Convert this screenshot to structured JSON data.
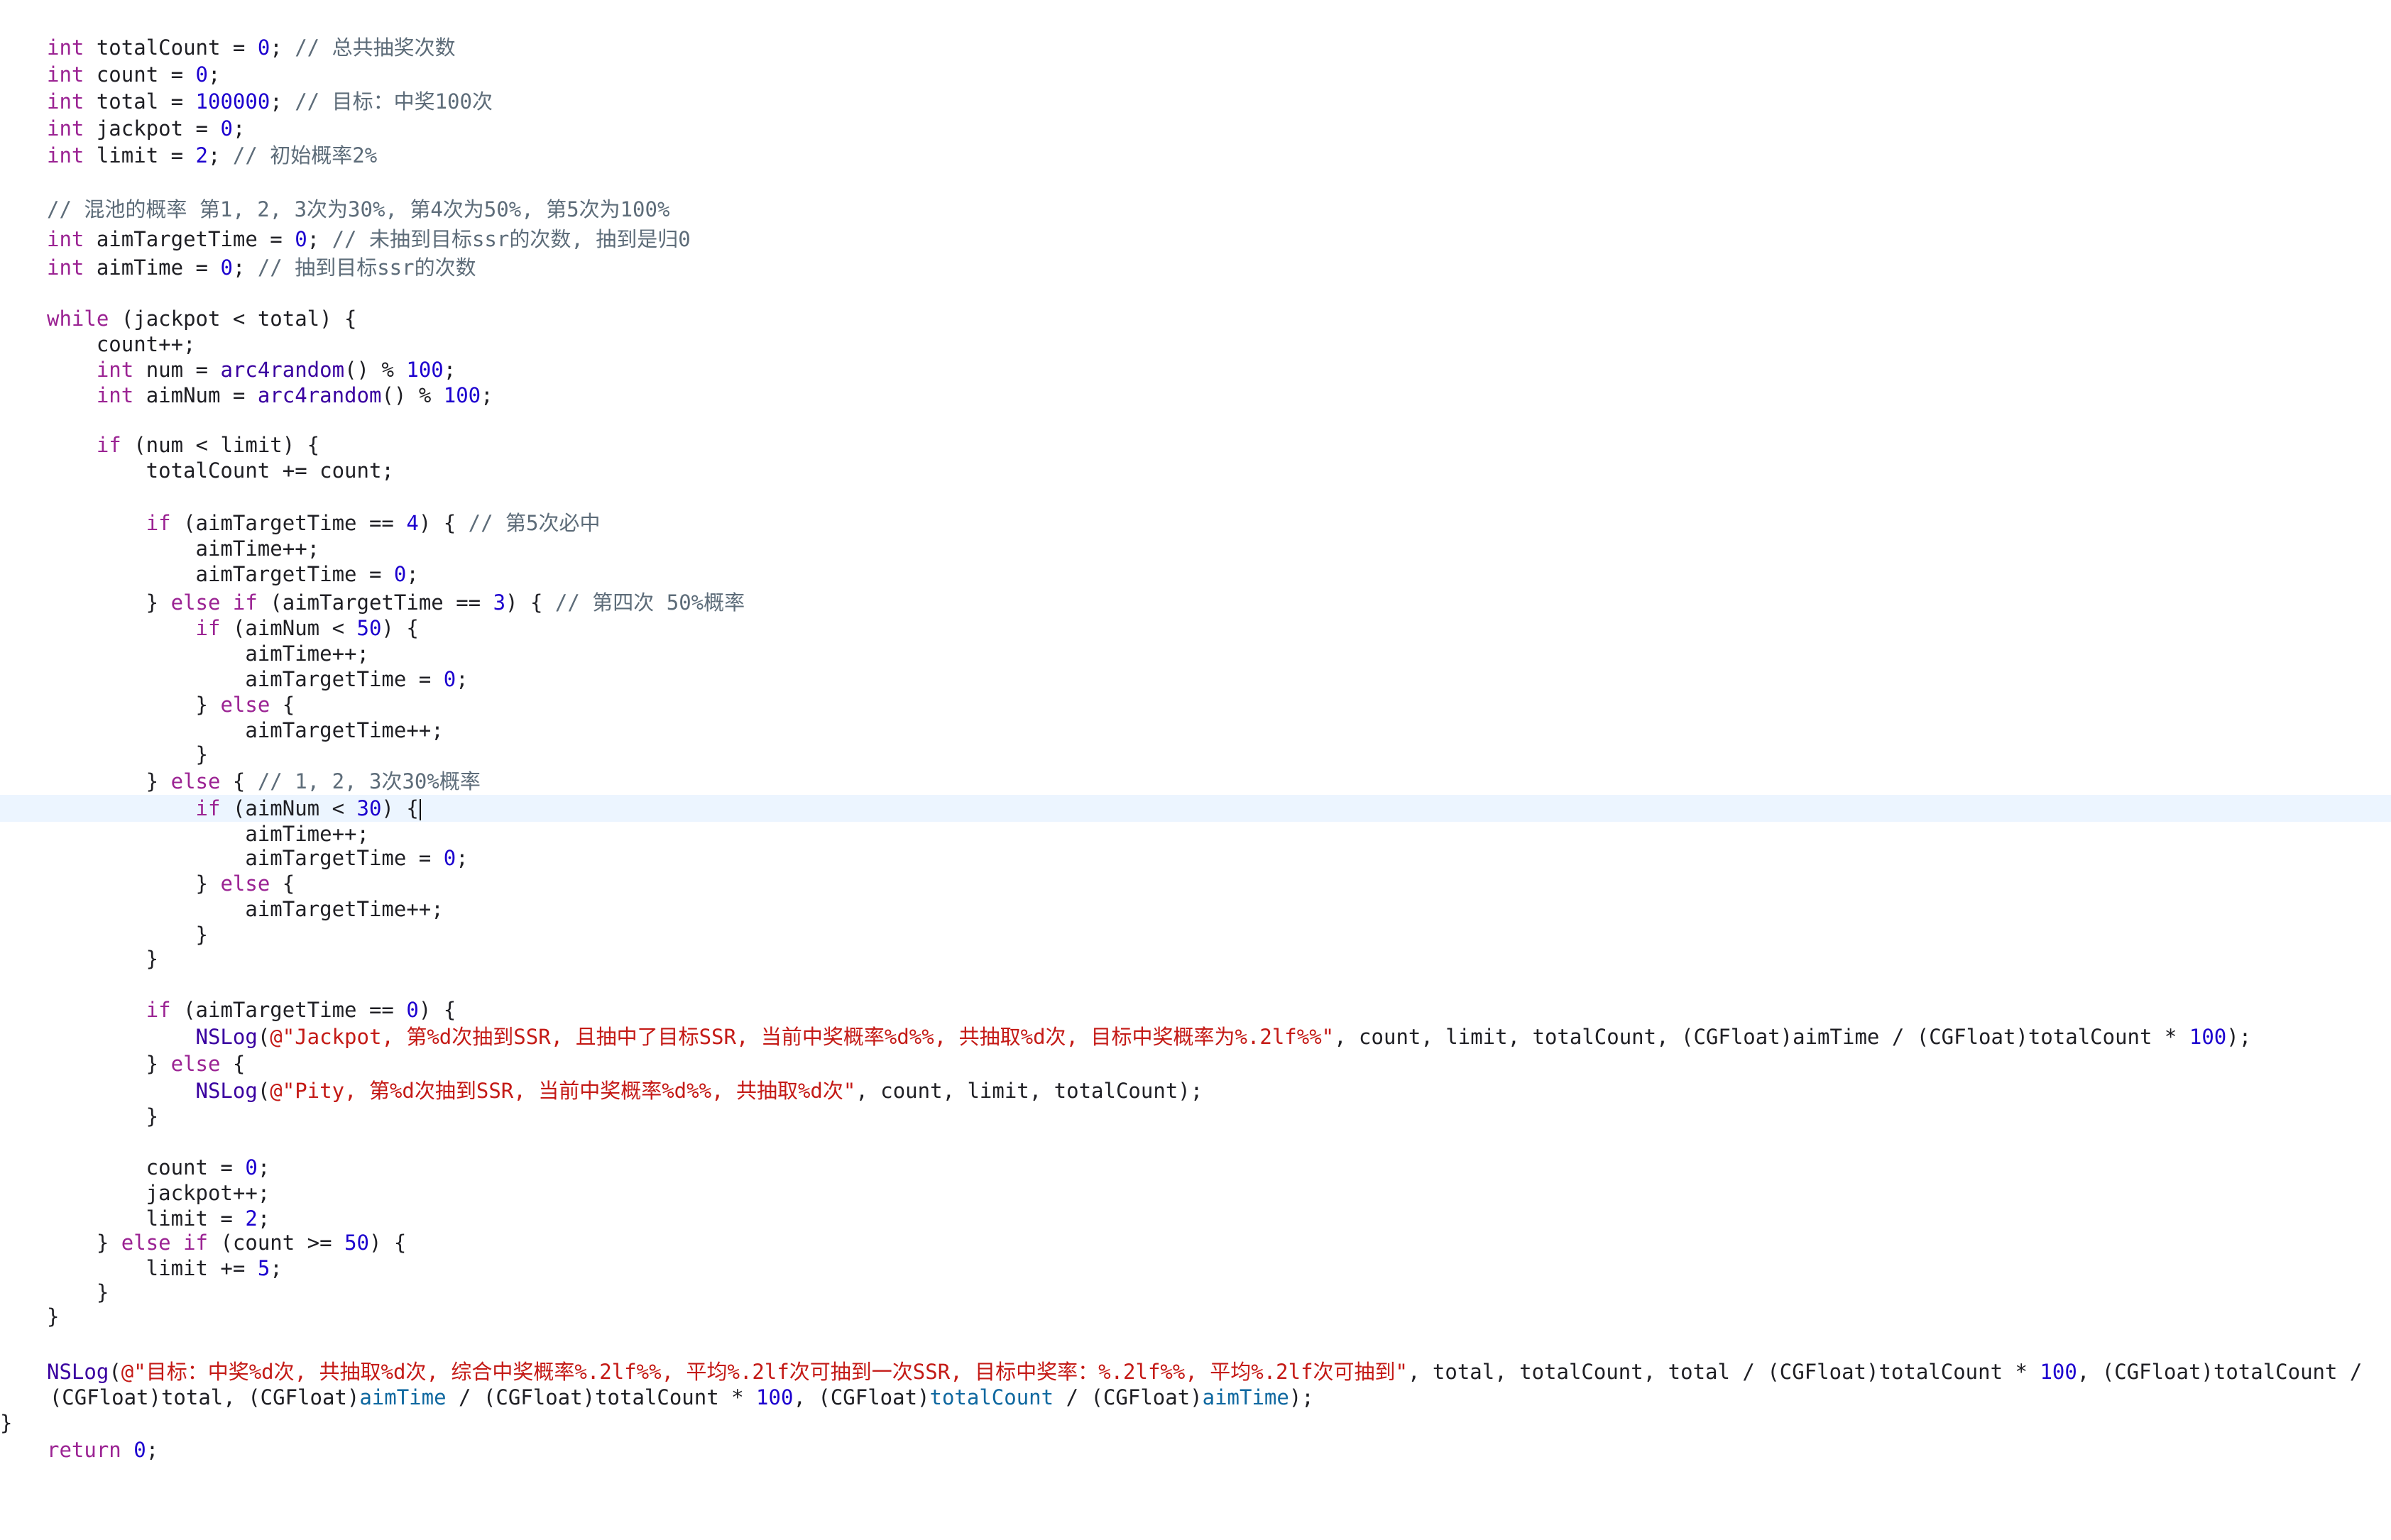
{
  "editor": {
    "colors": {
      "keyword": "#9b2393",
      "number": "#1c00cf",
      "comment": "#5d6c79",
      "string": "#c41a16",
      "function": "#3900a0",
      "variable": "#0f68a0",
      "plain": "#1f1f24",
      "current_line": "#ecf5ff"
    },
    "current_line_index": 29,
    "lines": [
      [
        {
          "t": "k",
          "s": "int"
        },
        {
          "t": "p",
          "s": " totalCount = "
        },
        {
          "t": "n",
          "s": "0"
        },
        {
          "t": "p",
          "s": "; "
        },
        {
          "t": "c",
          "s": "// 总共抽奖次数"
        }
      ],
      [
        {
          "t": "k",
          "s": "int"
        },
        {
          "t": "p",
          "s": " count = "
        },
        {
          "t": "n",
          "s": "0"
        },
        {
          "t": "p",
          "s": ";"
        }
      ],
      [
        {
          "t": "k",
          "s": "int"
        },
        {
          "t": "p",
          "s": " total = "
        },
        {
          "t": "n",
          "s": "100000"
        },
        {
          "t": "p",
          "s": "; "
        },
        {
          "t": "c",
          "s": "// 目标：中奖100次"
        }
      ],
      [
        {
          "t": "k",
          "s": "int"
        },
        {
          "t": "p",
          "s": " jackpot = "
        },
        {
          "t": "n",
          "s": "0"
        },
        {
          "t": "p",
          "s": ";"
        }
      ],
      [
        {
          "t": "k",
          "s": "int"
        },
        {
          "t": "p",
          "s": " limit = "
        },
        {
          "t": "n",
          "s": "2"
        },
        {
          "t": "p",
          "s": "; "
        },
        {
          "t": "c",
          "s": "// 初始概率2%"
        }
      ],
      [],
      [
        {
          "t": "c",
          "s": "// 混池的概率 第1, 2, 3次为30%, 第4次为50%, 第5次为100%"
        }
      ],
      [
        {
          "t": "k",
          "s": "int"
        },
        {
          "t": "p",
          "s": " aimTargetTime = "
        },
        {
          "t": "n",
          "s": "0"
        },
        {
          "t": "p",
          "s": "; "
        },
        {
          "t": "c",
          "s": "// 未抽到目标ssr的次数, 抽到是归0"
        }
      ],
      [
        {
          "t": "k",
          "s": "int"
        },
        {
          "t": "p",
          "s": " aimTime = "
        },
        {
          "t": "n",
          "s": "0"
        },
        {
          "t": "p",
          "s": "; "
        },
        {
          "t": "c",
          "s": "// 抽到目标ssr的次数"
        }
      ],
      [],
      [
        {
          "t": "k",
          "s": "while"
        },
        {
          "t": "p",
          "s": " (jackpot < total) {"
        }
      ],
      [
        {
          "t": "p",
          "s": "    count++;"
        }
      ],
      [
        {
          "t": "p",
          "s": "    "
        },
        {
          "t": "k",
          "s": "int"
        },
        {
          "t": "p",
          "s": " num = "
        },
        {
          "t": "f",
          "s": "arc4random"
        },
        {
          "t": "p",
          "s": "() % "
        },
        {
          "t": "n",
          "s": "100"
        },
        {
          "t": "p",
          "s": ";"
        }
      ],
      [
        {
          "t": "p",
          "s": "    "
        },
        {
          "t": "k",
          "s": "int"
        },
        {
          "t": "p",
          "s": " aimNum = "
        },
        {
          "t": "f",
          "s": "arc4random"
        },
        {
          "t": "p",
          "s": "() % "
        },
        {
          "t": "n",
          "s": "100"
        },
        {
          "t": "p",
          "s": ";"
        }
      ],
      [],
      [
        {
          "t": "p",
          "s": "    "
        },
        {
          "t": "k",
          "s": "if"
        },
        {
          "t": "p",
          "s": " (num < limit) {"
        }
      ],
      [
        {
          "t": "p",
          "s": "        totalCount += count;"
        }
      ],
      [],
      [
        {
          "t": "p",
          "s": "        "
        },
        {
          "t": "k",
          "s": "if"
        },
        {
          "t": "p",
          "s": " (aimTargetTime == "
        },
        {
          "t": "n",
          "s": "4"
        },
        {
          "t": "p",
          "s": ") { "
        },
        {
          "t": "c",
          "s": "// 第5次必中"
        }
      ],
      [
        {
          "t": "p",
          "s": "            aimTime++;"
        }
      ],
      [
        {
          "t": "p",
          "s": "            aimTargetTime = "
        },
        {
          "t": "n",
          "s": "0"
        },
        {
          "t": "p",
          "s": ";"
        }
      ],
      [
        {
          "t": "p",
          "s": "        } "
        },
        {
          "t": "k",
          "s": "else"
        },
        {
          "t": "p",
          "s": " "
        },
        {
          "t": "k",
          "s": "if"
        },
        {
          "t": "p",
          "s": " (aimTargetTime == "
        },
        {
          "t": "n",
          "s": "3"
        },
        {
          "t": "p",
          "s": ") { "
        },
        {
          "t": "c",
          "s": "// 第四次 50%概率"
        }
      ],
      [
        {
          "t": "p",
          "s": "            "
        },
        {
          "t": "k",
          "s": "if"
        },
        {
          "t": "p",
          "s": " (aimNum < "
        },
        {
          "t": "n",
          "s": "50"
        },
        {
          "t": "p",
          "s": ") {"
        }
      ],
      [
        {
          "t": "p",
          "s": "                aimTime++;"
        }
      ],
      [
        {
          "t": "p",
          "s": "                aimTargetTime = "
        },
        {
          "t": "n",
          "s": "0"
        },
        {
          "t": "p",
          "s": ";"
        }
      ],
      [
        {
          "t": "p",
          "s": "            } "
        },
        {
          "t": "k",
          "s": "else"
        },
        {
          "t": "p",
          "s": " {"
        }
      ],
      [
        {
          "t": "p",
          "s": "                aimTargetTime++;"
        }
      ],
      [
        {
          "t": "p",
          "s": "            }"
        }
      ],
      [
        {
          "t": "p",
          "s": "        } "
        },
        {
          "t": "k",
          "s": "else"
        },
        {
          "t": "p",
          "s": " { "
        },
        {
          "t": "c",
          "s": "// 1, 2, 3次30%概率"
        }
      ],
      [
        {
          "t": "p",
          "s": "            "
        },
        {
          "t": "k",
          "s": "if"
        },
        {
          "t": "p",
          "s": " (aimNum < "
        },
        {
          "t": "n",
          "s": "30"
        },
        {
          "t": "p",
          "s": ") {"
        }
      ],
      [
        {
          "t": "p",
          "s": "                aimTime++;"
        }
      ],
      [
        {
          "t": "p",
          "s": "                aimTargetTime = "
        },
        {
          "t": "n",
          "s": "0"
        },
        {
          "t": "p",
          "s": ";"
        }
      ],
      [
        {
          "t": "p",
          "s": "            } "
        },
        {
          "t": "k",
          "s": "else"
        },
        {
          "t": "p",
          "s": " {"
        }
      ],
      [
        {
          "t": "p",
          "s": "                aimTargetTime++;"
        }
      ],
      [
        {
          "t": "p",
          "s": "            }"
        }
      ],
      [
        {
          "t": "p",
          "s": "        }"
        }
      ],
      [],
      [
        {
          "t": "p",
          "s": "        "
        },
        {
          "t": "k",
          "s": "if"
        },
        {
          "t": "p",
          "s": " (aimTargetTime == "
        },
        {
          "t": "n",
          "s": "0"
        },
        {
          "t": "p",
          "s": ") {"
        }
      ],
      [
        {
          "t": "p",
          "s": "            "
        },
        {
          "t": "f",
          "s": "NSLog"
        },
        {
          "t": "p",
          "s": "("
        },
        {
          "t": "s",
          "s": "@\"Jackpot, 第%d次抽到SSR, 且抽中了目标SSR, 当前中奖概率%d%%, 共抽取%d次, 目标中奖概率为%.2lf%%\""
        },
        {
          "t": "p",
          "s": ", count, limit, totalCount, (CGFloat)aimTime / (CGFloat)totalCount * "
        },
        {
          "t": "n",
          "s": "100"
        },
        {
          "t": "p",
          "s": ");"
        }
      ],
      [
        {
          "t": "p",
          "s": "        } "
        },
        {
          "t": "k",
          "s": "else"
        },
        {
          "t": "p",
          "s": " {"
        }
      ],
      [
        {
          "t": "p",
          "s": "            "
        },
        {
          "t": "f",
          "s": "NSLog"
        },
        {
          "t": "p",
          "s": "("
        },
        {
          "t": "s",
          "s": "@\"Pity, 第%d次抽到SSR, 当前中奖概率%d%%, 共抽取%d次\""
        },
        {
          "t": "p",
          "s": ", count, limit, totalCount);"
        }
      ],
      [
        {
          "t": "p",
          "s": "        }"
        }
      ],
      [],
      [
        {
          "t": "p",
          "s": "        count = "
        },
        {
          "t": "n",
          "s": "0"
        },
        {
          "t": "p",
          "s": ";"
        }
      ],
      [
        {
          "t": "p",
          "s": "        jackpot++;"
        }
      ],
      [
        {
          "t": "p",
          "s": "        limit = "
        },
        {
          "t": "n",
          "s": "2"
        },
        {
          "t": "p",
          "s": ";"
        }
      ],
      [
        {
          "t": "p",
          "s": "    } "
        },
        {
          "t": "k",
          "s": "else"
        },
        {
          "t": "p",
          "s": " "
        },
        {
          "t": "k",
          "s": "if"
        },
        {
          "t": "p",
          "s": " (count >= "
        },
        {
          "t": "n",
          "s": "50"
        },
        {
          "t": "p",
          "s": ") {"
        }
      ],
      [
        {
          "t": "p",
          "s": "        limit += "
        },
        {
          "t": "n",
          "s": "5"
        },
        {
          "t": "p",
          "s": ";"
        }
      ],
      [
        {
          "t": "p",
          "s": "    }"
        }
      ],
      [
        {
          "t": "p",
          "s": "}"
        }
      ],
      [],
      [
        {
          "t": "f",
          "s": "NSLog"
        },
        {
          "t": "p",
          "s": "("
        },
        {
          "t": "s",
          "s": "@\"目标：中奖%d次, 共抽取%d次, 综合中奖概率%.2lf%%, 平均%.2lf次可抽到一次SSR, 目标中奖率：%.2lf%%, 平均%.2lf次可抽到\""
        },
        {
          "t": "p",
          "s": ", total, totalCount, total / (CGFloat)totalCount * "
        },
        {
          "t": "n",
          "s": "100"
        },
        {
          "t": "p",
          "s": ", (CGFloat)totalCount /"
        }
      ],
      [
        {
          "t": "p",
          "s": "    (CGFloat)total, (CGFloat)"
        },
        {
          "t": "v",
          "s": "aimTime"
        },
        {
          "t": "p",
          "s": " / (CGFloat)totalCount * "
        },
        {
          "t": "n",
          "s": "100"
        },
        {
          "t": "p",
          "s": ", (CGFloat)"
        },
        {
          "t": "v",
          "s": "totalCount"
        },
        {
          "t": "p",
          "s": " / (CGFloat)"
        },
        {
          "t": "v",
          "s": "aimTime"
        },
        {
          "t": "p",
          "s": ");"
        }
      ],
      [
        {
          "t": "p",
          "s": "}"
        }
      ],
      [
        {
          "t": "k",
          "s": "return"
        },
        {
          "t": "p",
          "s": " "
        },
        {
          "t": "n",
          "s": "0"
        },
        {
          "t": "p",
          "s": ";"
        }
      ]
    ]
  }
}
